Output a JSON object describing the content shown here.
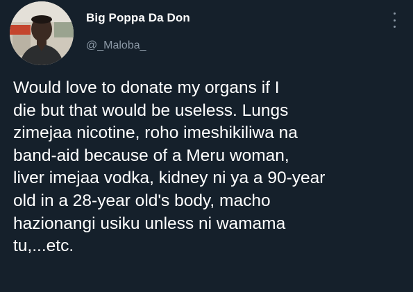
{
  "author": {
    "display_name": "Big Poppa Da Don",
    "handle": "@_Maloba_"
  },
  "more_icon": "three-dots-vertical-icon",
  "tweet": {
    "text": "Would love to donate my organs if I\ndie but that would be useless. Lungs\nzimejaa nicotine, roho imeshikiliwa na\nband-aid because of a Meru woman,\nliver imejaa vodka, kidney ni ya a 90-year\nold in a 28-year old's body, macho\nhazionangi usiku unless ni wamama\ntu,...etc."
  },
  "colors": {
    "background": "#15202b",
    "primary_text": "#ffffff",
    "secondary_text": "#8b98a5"
  }
}
